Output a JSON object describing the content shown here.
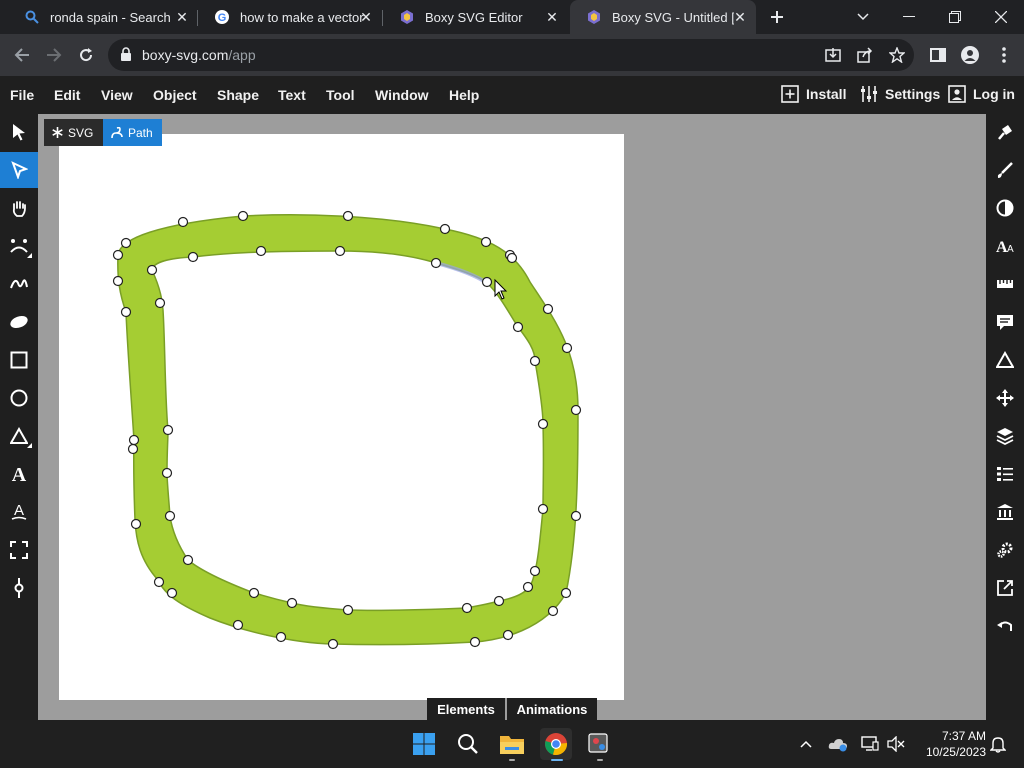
{
  "browser": {
    "tabs": [
      {
        "title": "ronda spain - Search",
        "icon": "search-icon"
      },
      {
        "title": "how to make a vector i",
        "icon": "google-icon"
      },
      {
        "title": "Boxy SVG Editor",
        "icon": "boxy-svg-icon"
      },
      {
        "title": "Boxy SVG - Untitled [Ec",
        "icon": "boxy-svg-icon",
        "active": true
      }
    ],
    "url_host": "boxy-svg.com",
    "url_path": "/app"
  },
  "menubar": {
    "items": [
      "File",
      "Edit",
      "View",
      "Object",
      "Shape",
      "Text",
      "Tool",
      "Window",
      "Help"
    ],
    "install": "Install",
    "settings": "Settings",
    "login": "Log in"
  },
  "breadcrumb": {
    "svg": "SVG",
    "path": "Path"
  },
  "left_tools": [
    "arrow-select-tool-icon",
    "edit-path-tool-icon",
    "hand-pan-tool-icon",
    "face-tool-icon",
    "freehand-tool-icon",
    "pencil-blob-tool-icon",
    "rectangle-tool-icon",
    "ellipse-tool-icon",
    "triangle-tool-icon",
    "text-tool-icon",
    "text-path-tool-icon",
    "crop-tool-icon",
    "gradient-tool-icon"
  ],
  "right_tools": [
    "fill-icon",
    "stroke-icon",
    "compositing-icon",
    "typography-icon",
    "measure-icon",
    "comments-icon",
    "geometry-icon",
    "transform-icon",
    "elements-icon",
    "defs-icon",
    "library-icon",
    "generators-icon",
    "export-icon",
    "history-icon"
  ],
  "bottom_tabs": {
    "elements": "Elements",
    "animations": "Animations"
  },
  "taskbar": {
    "time": "7:37 AM",
    "date": "10/25/2023"
  },
  "colors": {
    "shape_fill": "#a5cd33",
    "shape_stroke": "#7a9f26",
    "accent": "#1e7fd4"
  }
}
